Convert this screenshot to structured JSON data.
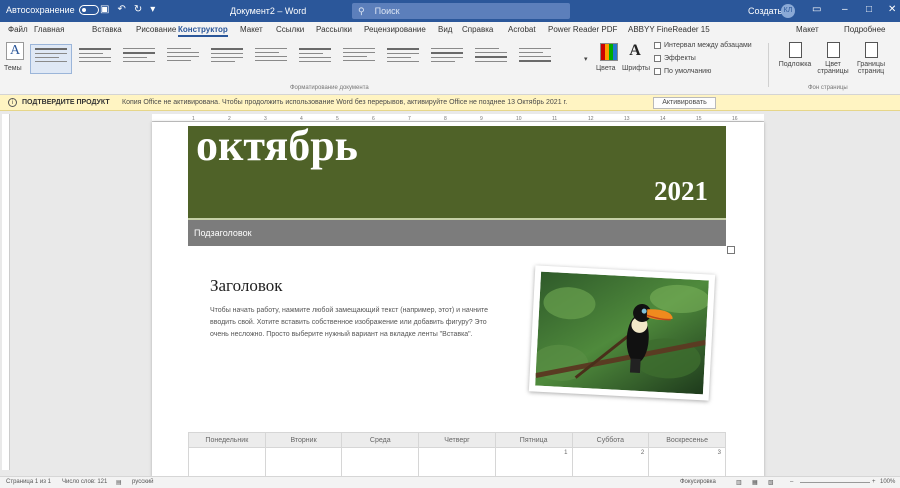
{
  "titlebar": {
    "autosave_label": "Автосохранение",
    "autosave_state": "off",
    "document_title": "Документ2 – Word",
    "search_placeholder": "Поиск",
    "user_name": "Создать",
    "avatar_initials": "КЛ",
    "colors": {
      "bar": "#2b579a"
    }
  },
  "tabs": [
    "Файл",
    "Главная",
    "Вставка",
    "Рисование",
    "Конструктор",
    "Макет",
    "Ссылки",
    "Рассылки",
    "Рецензирование",
    "Вид",
    "Справка",
    "Acrobat",
    "Power Reader PDF",
    "ABBYY FineReader 15",
    "Макет",
    "Подробнее"
  ],
  "active_tab": "Конструктор",
  "ribbon": {
    "themes_label": "Темы",
    "style_set_label": "Форматирование документа",
    "colors_label": "Цвета",
    "fonts_label": "Шрифты",
    "paragraph_spacing_label": "Интервал между абзацами",
    "effects_label": "Эффекты",
    "set_default_label": "По умолчанию",
    "page_background_label": "Фон страницы",
    "watermark_label": "Подложка",
    "page_color_label": "Цвет страницы",
    "page_borders_label": "Границы страниц"
  },
  "infobar": {
    "title": "ПОДТВЕРДИТЕ ПРОДУКТ",
    "message": "Копия Office не активирована. Чтобы продолжить использование Word без перерывов, активируйте Office не позднее 13 Октябрь 2021 г.",
    "action_label": "Активировать",
    "colors": {
      "background": "#fff4c2"
    }
  },
  "ruler": {
    "ticks": [
      "1",
      "2",
      "3",
      "4",
      "5",
      "6",
      "7",
      "8",
      "9",
      "10",
      "11",
      "12",
      "13",
      "14",
      "15",
      "16"
    ]
  },
  "document": {
    "month": "октябрь",
    "year": "2021",
    "subtitle": "Подзаголовок",
    "heading": "Заголовок",
    "body": "Чтобы начать работу, нажмите любой замещающий текст (например, этот) и начните вводить свой. Хотите вставить собственное изображение или добавить фигуру? Это очень несложно. Просто выберите нужный вариант на вкладке ленты \"Вставка\".",
    "calendar": {
      "days": [
        "Понедельник",
        "Вторник",
        "Среда",
        "Четверг",
        "Пятница",
        "Суббота",
        "Воскресенье"
      ],
      "first_row": [
        "",
        "",
        "",
        "",
        "1",
        "2",
        "3"
      ]
    },
    "colors": {
      "banner": "#4f6228",
      "subtitle_bar": "#7c7c7c"
    }
  },
  "statusbar": {
    "page": "Страница 1 из 1",
    "words": "Число слов: 121",
    "language": "русский",
    "focus": "Фокусировка",
    "zoom": "100%"
  }
}
